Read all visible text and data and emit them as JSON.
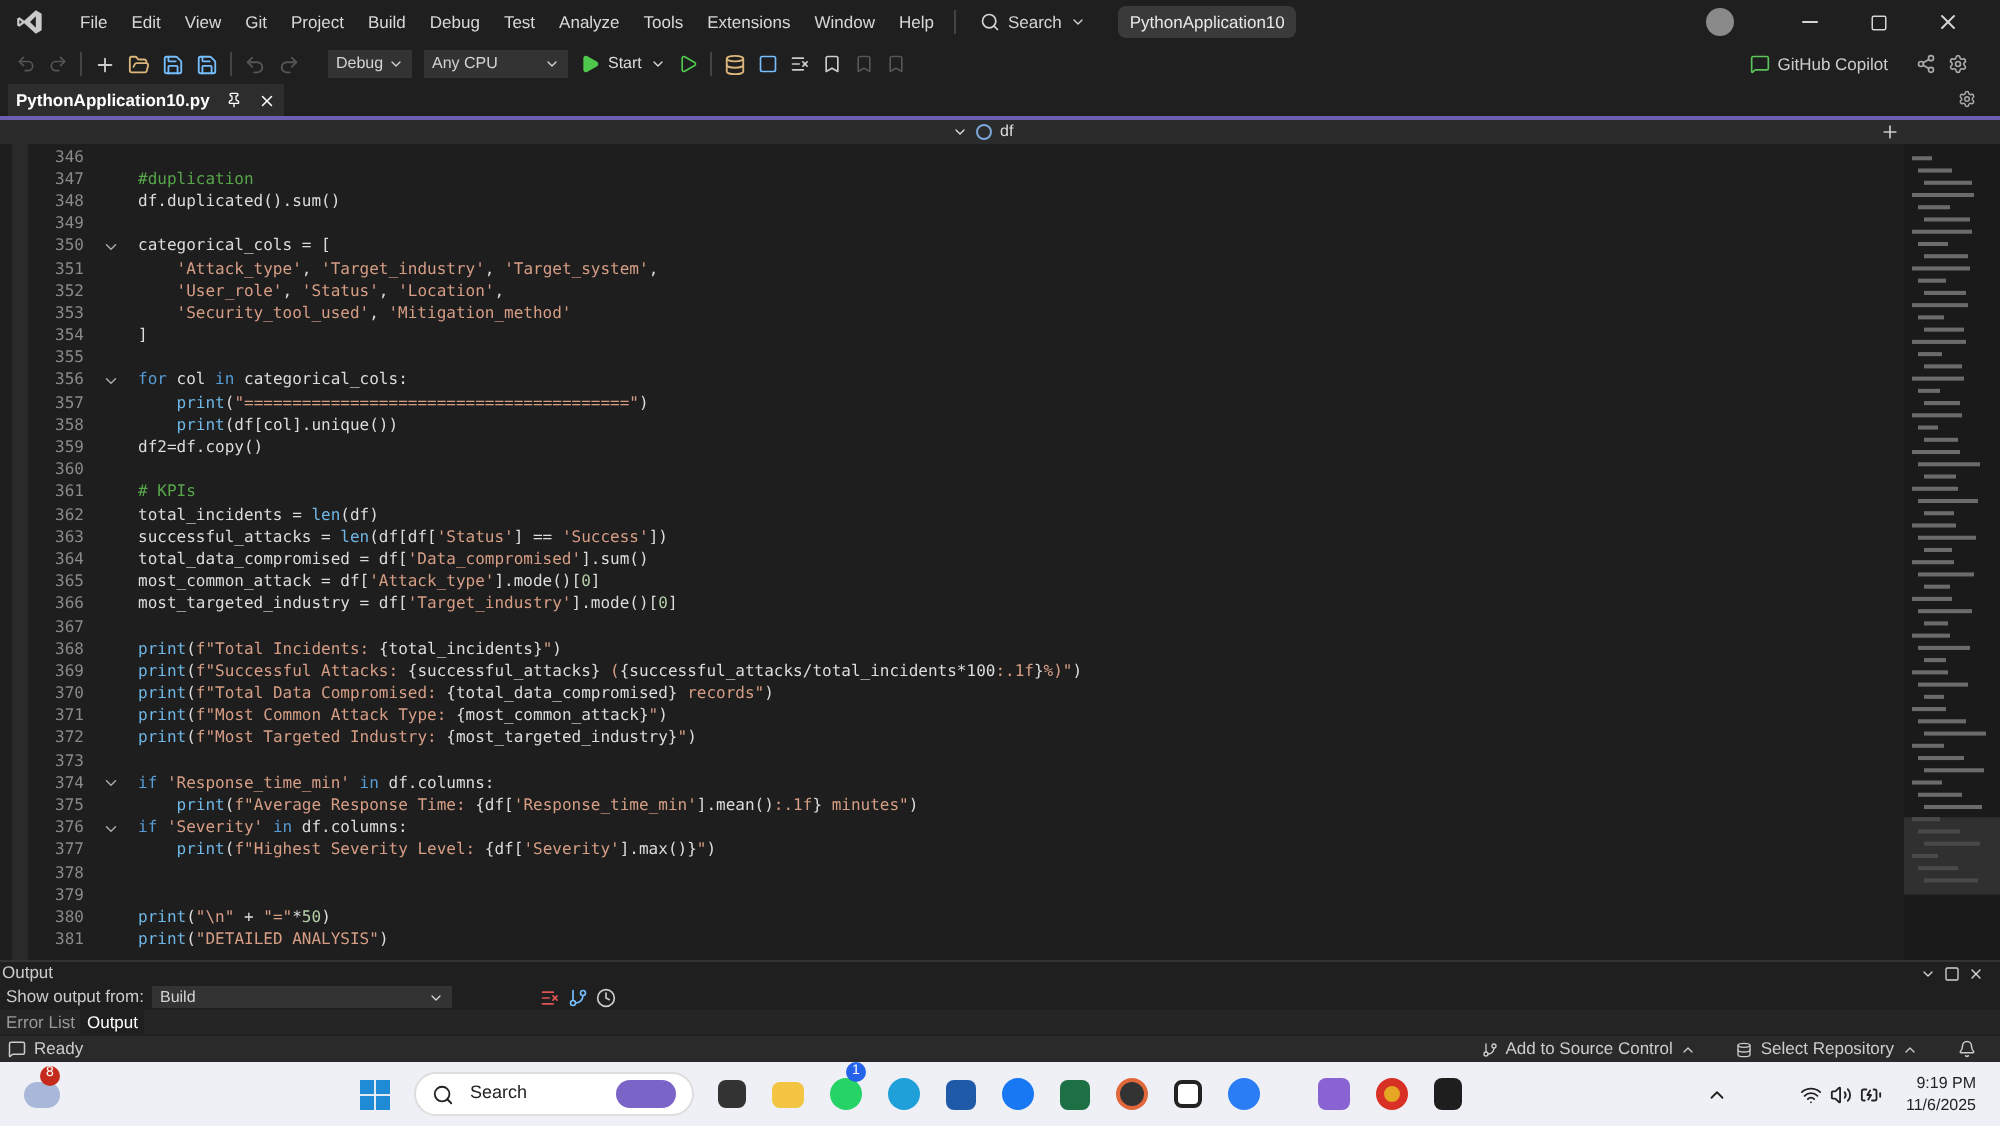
{
  "menu": {
    "items": [
      "File",
      "Edit",
      "View",
      "Git",
      "Project",
      "Build",
      "Debug",
      "Test",
      "Analyze",
      "Tools",
      "Extensions",
      "Window",
      "Help"
    ],
    "search": "Search",
    "solution": "PythonApplication10"
  },
  "toolbar": {
    "configuration": "Debug",
    "platform": "Any CPU",
    "start": "Start",
    "copilot": "GitHub Copilot"
  },
  "tabs": [
    {
      "label": "PythonApplication10.py",
      "selected": true
    }
  ],
  "navigation": {
    "member": "df"
  },
  "editor": {
    "lines": [
      {
        "number": "346",
        "fold": false
      },
      {
        "number": "347",
        "fold": false,
        "tokens": [
          {
            "kind": "comment",
            "text": "#duplication"
          }
        ]
      },
      {
        "number": "348",
        "fold": false,
        "tokens": [
          {
            "kind": "plain",
            "text": "df.duplicated().sum()"
          }
        ]
      },
      {
        "number": "349",
        "fold": false
      },
      {
        "number": "350",
        "fold": true,
        "tokens": [
          {
            "kind": "plain",
            "text": "categorical_cols = ["
          }
        ]
      },
      {
        "number": "351",
        "fold": false,
        "tokens": [
          {
            "kind": "string",
            "text": "    'Attack_type'"
          },
          {
            "kind": "plain",
            "text": ", "
          },
          {
            "kind": "string",
            "text": "'Target_industry'"
          },
          {
            "kind": "plain",
            "text": ", "
          },
          {
            "kind": "string",
            "text": "'Target_system'"
          },
          {
            "kind": "plain",
            "text": ","
          }
        ]
      },
      {
        "number": "352",
        "fold": false,
        "tokens": [
          {
            "kind": "string",
            "text": "    'User_role'"
          },
          {
            "kind": "plain",
            "text": ", "
          },
          {
            "kind": "string",
            "text": "'Status'"
          },
          {
            "kind": "plain",
            "text": ", "
          },
          {
            "kind": "string",
            "text": "'Location'"
          },
          {
            "kind": "plain",
            "text": ","
          }
        ]
      },
      {
        "number": "353",
        "fold": false,
        "tokens": [
          {
            "kind": "string",
            "text": "    'Security_tool_used'"
          },
          {
            "kind": "plain",
            "text": ", "
          },
          {
            "kind": "string",
            "text": "'Mitigation_method'"
          }
        ]
      },
      {
        "number": "354",
        "fold": false,
        "tokens": [
          {
            "kind": "plain",
            "text": "]"
          }
        ]
      },
      {
        "number": "355",
        "fold": false
      },
      {
        "number": "356",
        "fold": true,
        "tokens": [
          {
            "kind": "keyword",
            "text": "for"
          },
          {
            "kind": "plain",
            "text": " col "
          },
          {
            "kind": "keyword",
            "text": "in"
          },
          {
            "kind": "plain",
            "text": " categorical_cols:"
          }
        ]
      },
      {
        "number": "357",
        "fold": false,
        "tokens": [
          {
            "kind": "function",
            "text": "    print"
          },
          {
            "kind": "plain",
            "text": "("
          },
          {
            "kind": "string",
            "text": "\"========================================\""
          },
          {
            "kind": "plain",
            "text": ")"
          }
        ]
      },
      {
        "number": "358",
        "fold": false,
        "tokens": [
          {
            "kind": "function",
            "text": "    print"
          },
          {
            "kind": "plain",
            "text": "(df[col].unique())"
          }
        ]
      },
      {
        "number": "359",
        "fold": false,
        "tokens": [
          {
            "kind": "plain",
            "text": "df2=df.copy()"
          }
        ]
      },
      {
        "number": "360",
        "fold": false
      },
      {
        "number": "361",
        "fold": false,
        "tokens": [
          {
            "kind": "comment",
            "text": "# KPIs"
          }
        ]
      },
      {
        "number": "362",
        "fold": false,
        "tokens": [
          {
            "kind": "plain",
            "text": "total_incidents = "
          },
          {
            "kind": "function",
            "text": "len"
          },
          {
            "kind": "plain",
            "text": "(df)"
          }
        ]
      },
      {
        "number": "363",
        "fold": false,
        "tokens": [
          {
            "kind": "plain",
            "text": "successful_attacks = "
          },
          {
            "kind": "function",
            "text": "len"
          },
          {
            "kind": "plain",
            "text": "(df[df["
          },
          {
            "kind": "string",
            "text": "'Status'"
          },
          {
            "kind": "plain",
            "text": "] == "
          },
          {
            "kind": "string",
            "text": "'Success'"
          },
          {
            "kind": "plain",
            "text": "])"
          }
        ]
      },
      {
        "number": "364",
        "fold": false,
        "tokens": [
          {
            "kind": "plain",
            "text": "total_data_compromised = df["
          },
          {
            "kind": "string",
            "text": "'Data_compromised'"
          },
          {
            "kind": "plain",
            "text": "].sum()"
          }
        ]
      },
      {
        "number": "365",
        "fold": false,
        "tokens": [
          {
            "kind": "plain",
            "text": "most_common_attack = df["
          },
          {
            "kind": "string",
            "text": "'Attack_type'"
          },
          {
            "kind": "plain",
            "text": "].mode()["
          },
          {
            "kind": "number",
            "text": "0"
          },
          {
            "kind": "plain",
            "text": "]"
          }
        ]
      },
      {
        "number": "366",
        "fold": false,
        "tokens": [
          {
            "kind": "plain",
            "text": "most_targeted_industry = df["
          },
          {
            "kind": "string",
            "text": "'Target_industry'"
          },
          {
            "kind": "plain",
            "text": "].mode()["
          },
          {
            "kind": "number",
            "text": "0"
          },
          {
            "kind": "plain",
            "text": "]"
          }
        ]
      },
      {
        "number": "367",
        "fold": false
      },
      {
        "number": "368",
        "fold": false,
        "tokens": [
          {
            "kind": "function",
            "text": "print"
          },
          {
            "kind": "plain",
            "text": "("
          },
          {
            "kind": "string",
            "text": "f\"Total Incidents: "
          },
          {
            "kind": "plain",
            "text": "{total_incidents}"
          },
          {
            "kind": "string",
            "text": "\""
          },
          {
            "kind": "plain",
            "text": ")"
          }
        ]
      },
      {
        "number": "369",
        "fold": false,
        "tokens": [
          {
            "kind": "function",
            "text": "print"
          },
          {
            "kind": "plain",
            "text": "("
          },
          {
            "kind": "string",
            "text": "f\"Successful Attacks: "
          },
          {
            "kind": "plain",
            "text": "{successful_attacks}"
          },
          {
            "kind": "string",
            "text": " ("
          },
          {
            "kind": "plain",
            "text": "{successful_attacks/total_incidents*100"
          },
          {
            "kind": "string",
            "text": ":.1f"
          },
          {
            "kind": "plain",
            "text": "}"
          },
          {
            "kind": "string",
            "text": "%)\""
          },
          {
            "kind": "plain",
            "text": ")"
          }
        ]
      },
      {
        "number": "370",
        "fold": false,
        "tokens": [
          {
            "kind": "function",
            "text": "print"
          },
          {
            "kind": "plain",
            "text": "("
          },
          {
            "kind": "string",
            "text": "f\"Total Data Compromised: "
          },
          {
            "kind": "plain",
            "text": "{total_data_compromised}"
          },
          {
            "kind": "string",
            "text": " records\""
          },
          {
            "kind": "plain",
            "text": ")"
          }
        ]
      },
      {
        "number": "371",
        "fold": false,
        "tokens": [
          {
            "kind": "function",
            "text": "print"
          },
          {
            "kind": "plain",
            "text": "("
          },
          {
            "kind": "string",
            "text": "f\"Most Common Attack Type: "
          },
          {
            "kind": "plain",
            "text": "{most_common_attack}"
          },
          {
            "kind": "string",
            "text": "\""
          },
          {
            "kind": "plain",
            "text": ")"
          }
        ]
      },
      {
        "number": "372",
        "fold": false,
        "tokens": [
          {
            "kind": "function",
            "text": "print"
          },
          {
            "kind": "plain",
            "text": "("
          },
          {
            "kind": "string",
            "text": "f\"Most Targeted Industry: "
          },
          {
            "kind": "plain",
            "text": "{most_targeted_industry}"
          },
          {
            "kind": "string",
            "text": "\""
          },
          {
            "kind": "plain",
            "text": ")"
          }
        ]
      },
      {
        "number": "373",
        "fold": false
      },
      {
        "number": "374",
        "fold": true,
        "tokens": [
          {
            "kind": "keyword",
            "text": "if"
          },
          {
            "kind": "string",
            "text": " 'Response_time_min' "
          },
          {
            "kind": "keyword",
            "text": "in"
          },
          {
            "kind": "plain",
            "text": " df.columns:"
          }
        ]
      },
      {
        "number": "375",
        "fold": false,
        "tokens": [
          {
            "kind": "function",
            "text": "    print"
          },
          {
            "kind": "plain",
            "text": "("
          },
          {
            "kind": "string",
            "text": "f\"Average Response Time: "
          },
          {
            "kind": "plain",
            "text": "{df["
          },
          {
            "kind": "string",
            "text": "'Response_time_min'"
          },
          {
            "kind": "plain",
            "text": "].mean()"
          },
          {
            "kind": "string",
            "text": ":.1f"
          },
          {
            "kind": "plain",
            "text": "}"
          },
          {
            "kind": "string",
            "text": " minutes\""
          },
          {
            "kind": "plain",
            "text": ")"
          }
        ]
      },
      {
        "number": "376",
        "fold": true,
        "tokens": [
          {
            "kind": "keyword",
            "text": "if"
          },
          {
            "kind": "string",
            "text": " 'Severity' "
          },
          {
            "kind": "keyword",
            "text": "in"
          },
          {
            "kind": "plain",
            "text": " df.columns:"
          }
        ]
      },
      {
        "number": "377",
        "fold": false,
        "tokens": [
          {
            "kind": "function",
            "text": "    print"
          },
          {
            "kind": "plain",
            "text": "("
          },
          {
            "kind": "string",
            "text": "f\"Highest Severity Level: "
          },
          {
            "kind": "plain",
            "text": "{df["
          },
          {
            "kind": "string",
            "text": "'Severity'"
          },
          {
            "kind": "plain",
            "text": "].max()}"
          },
          {
            "kind": "string",
            "text": "\""
          },
          {
            "kind": "plain",
            "text": ")"
          }
        ]
      },
      {
        "number": "378",
        "fold": false
      },
      {
        "number": "379",
        "fold": false
      },
      {
        "number": "380",
        "fold": false,
        "tokens": [
          {
            "kind": "function",
            "text": "print"
          },
          {
            "kind": "plain",
            "text": "("
          },
          {
            "kind": "string",
            "text": "\"\\n\""
          },
          {
            "kind": "plain",
            "text": " + "
          },
          {
            "kind": "string",
            "text": "\"=\""
          },
          {
            "kind": "plain",
            "text": "*"
          },
          {
            "kind": "number",
            "text": "50"
          },
          {
            "kind": "plain",
            "text": ")"
          }
        ]
      },
      {
        "number": "381",
        "fold": false,
        "tokens": [
          {
            "kind": "function",
            "text": "print"
          },
          {
            "kind": "plain",
            "text": "("
          },
          {
            "kind": "string",
            "text": "\"DETAILED ANALYSIS\""
          },
          {
            "kind": "plain",
            "text": ")"
          }
        ]
      }
    ]
  },
  "output": {
    "title": "Output",
    "source_label": "Show output from:",
    "source": "Build",
    "tabs": [
      {
        "label": "Error List",
        "selected": false
      },
      {
        "label": "Output",
        "selected": true
      }
    ]
  },
  "status_bar": {
    "state": "Ready",
    "source_control": "Add to Source Control",
    "repository": "Select Repository"
  },
  "taskbar": {
    "weather_badge": "8",
    "search": "Search",
    "whatsapp_badge": "1",
    "time": "9:19 PM",
    "date": "11/6/2025"
  }
}
